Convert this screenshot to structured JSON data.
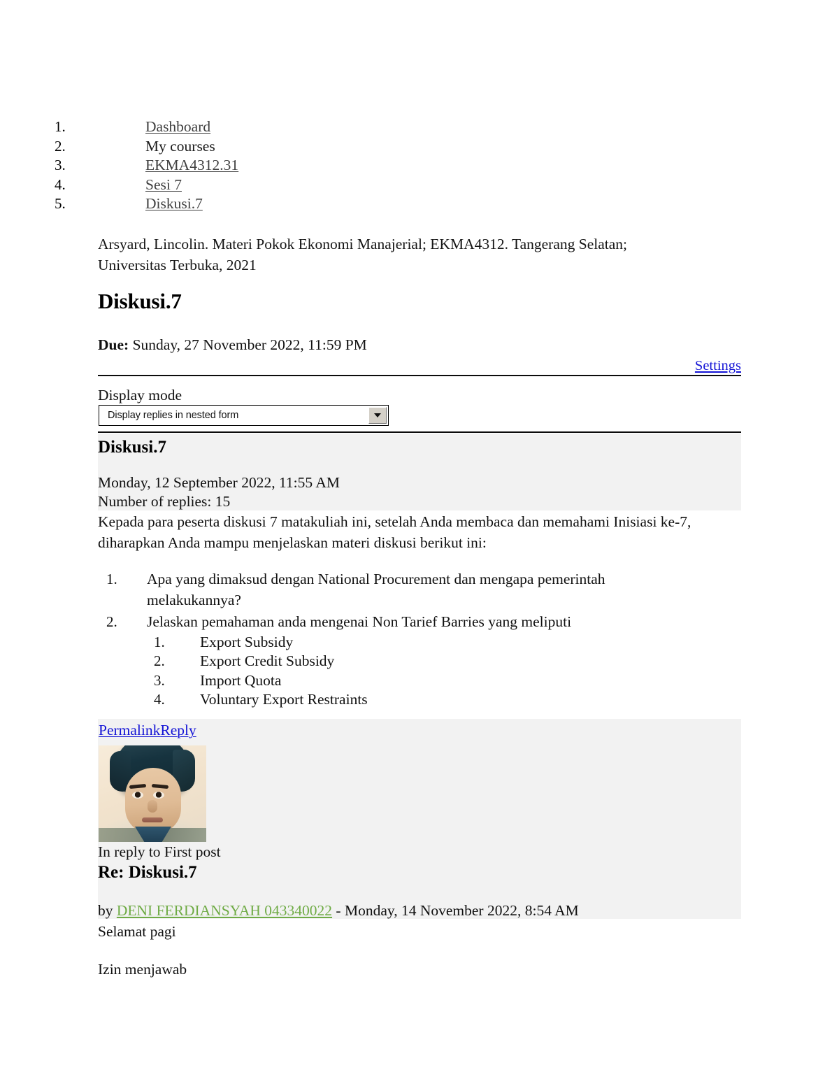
{
  "breadcrumb": {
    "items": [
      {
        "num": "1.",
        "label": "Dashboard",
        "is_link": true
      },
      {
        "num": "2.",
        "label": "My courses",
        "is_link": false
      },
      {
        "num": "3.",
        "label": "EKMA4312.31",
        "is_link": true
      },
      {
        "num": "4.",
        "label": "Sesi 7",
        "is_link": true
      },
      {
        "num": "5.",
        "label": "Diskusi.7",
        "is_link": true
      }
    ]
  },
  "citation": "Arsyard, Lincolin. Materi Pokok Ekonomi Manajerial; EKMA4312. Tangerang Selatan; Universitas Terbuka, 2021",
  "page_title": "Diskusi.7",
  "due": {
    "label": "Due:",
    "value": "Sunday, 27 November 2022, 11:59 PM"
  },
  "settings_link": "Settings",
  "display_mode": {
    "label": "Display mode",
    "selected": "Display replies in nested form",
    "chevron": "chevron-down-icon"
  },
  "first_post": {
    "title": "Diskusi.7",
    "date": "Monday, 12 September 2022, 11:55 AM",
    "replies": "Number of replies: 15",
    "body": "Kepada para peserta diskusi 7 matakuliah ini, setelah Anda membaca dan memahami Inisiasi ke-7, diharapkan Anda mampu menjelaskan materi diskusi berikut ini:",
    "questions": [
      {
        "num": "1.",
        "text": "Apa yang dimaksud dengan National Procurement dan mengapa pemerintah melakukannya?",
        "sub": []
      },
      {
        "num": "2.",
        "text": "Jelaskan pemahaman anda mengenai Non Tarief Barries yang meliputi",
        "sub": [
          {
            "num": "1.",
            "text": "Export Subsidy"
          },
          {
            "num": "2.",
            "text": "Export Credit Subsidy"
          },
          {
            "num": "3.",
            "text": "Import Quota"
          },
          {
            "num": "4.",
            "text": "Voluntary Export Restraints"
          }
        ]
      }
    ],
    "permalink_label": "Permalink",
    "reply_label": "Reply"
  },
  "reply_post": {
    "avatar": "user-avatar-photo",
    "in_reply_to": "In reply to First post",
    "title": "Re: Diskusi.7",
    "by_prefix": "by ",
    "author": "DENI FERDIANSYAH 043340022",
    "date_suffix": " - Monday, 14 November 2022, 8:54 AM",
    "body_line1": "Selamat pagi",
    "body_line2": "Izin menjawab"
  },
  "colors": {
    "link_blue": "#1414d6",
    "author_green": "#6fab45",
    "block_grey": "#f2f2f2",
    "rule_black": "#0c0c0c"
  }
}
